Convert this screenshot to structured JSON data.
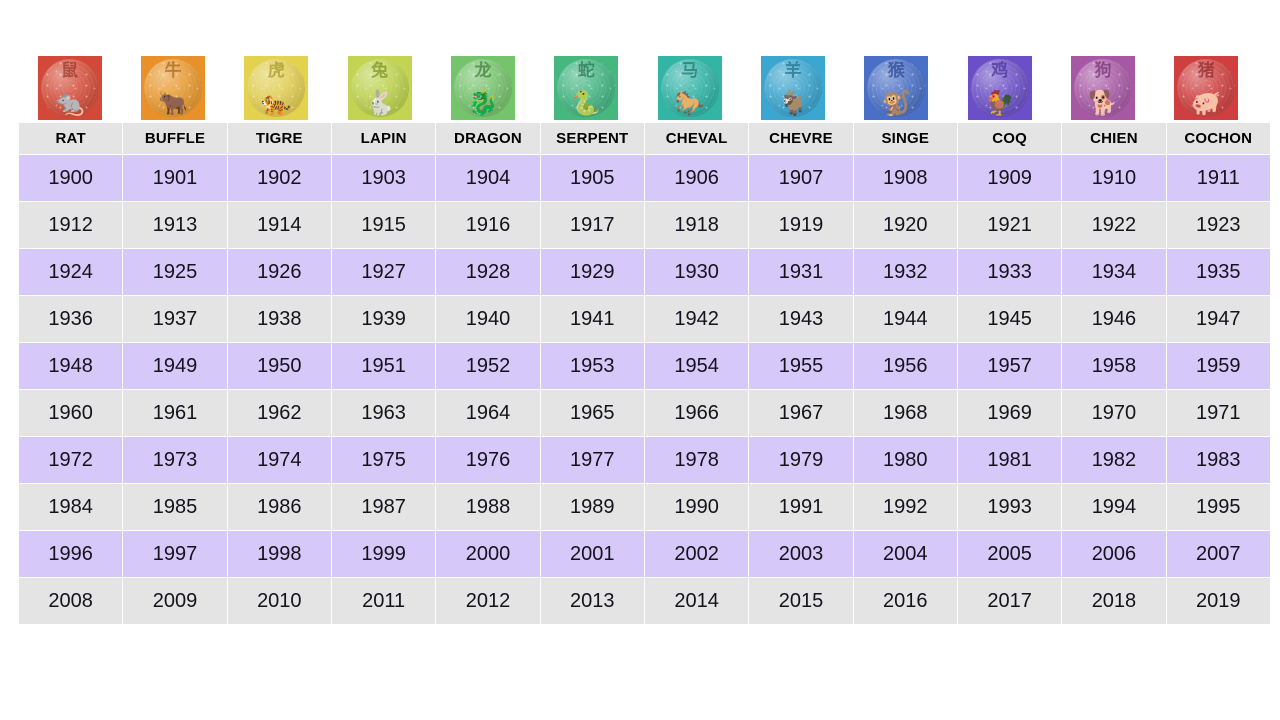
{
  "page": {
    "background": "#ffffff",
    "row_color_alt": "#d6c9fa",
    "row_color_base": "#e4e4e4",
    "header_background": "#e4e4e4"
  },
  "zodiac": {
    "signs": [
      {
        "label": "RAT",
        "icon_name": "zodiac-icon-rat",
        "color": "#d2493a",
        "disc_color": "#d4513f",
        "glyph_cn": "鼠",
        "glyph_animal": "🐀",
        "glyph_color": "#8e2b20",
        "animal_color": "#f0b9a0"
      },
      {
        "label": "BUFFLE",
        "icon_name": "zodiac-icon-buffle",
        "color": "#e8912b",
        "disc_color": "#e79a33",
        "glyph_cn": "牛",
        "glyph_animal": "🐂",
        "glyph_color": "#9c5c12",
        "animal_color": "#f6d6a8"
      },
      {
        "label": "TIGRE",
        "icon_name": "zodiac-icon-tigre",
        "color": "#e4d24e",
        "disc_color": "#e0ce55",
        "glyph_cn": "虎",
        "glyph_animal": "🐅",
        "glyph_color": "#9a8c1b",
        "animal_color": "#f6f0bd"
      },
      {
        "label": "LAPIN",
        "icon_name": "zodiac-icon-lapin",
        "color": "#c3d452",
        "disc_color": "#bcd14f",
        "glyph_cn": "兔",
        "glyph_animal": "🐇",
        "glyph_color": "#6f8417",
        "animal_color": "#f1f7d2"
      },
      {
        "label": "DRAGON",
        "icon_name": "zodiac-icon-dragon",
        "color": "#74c46b",
        "disc_color": "#77c26e",
        "glyph_cn": "龙",
        "glyph_animal": "🐉",
        "glyph_color": "#336f2c",
        "animal_color": "#e2f4df"
      },
      {
        "label": "SERPENT",
        "icon_name": "zodiac-icon-serpent",
        "color": "#46b87e",
        "disc_color": "#46b584",
        "glyph_cn": "蛇",
        "glyph_animal": "🐍",
        "glyph_color": "#176b43",
        "animal_color": "#d9f3e6"
      },
      {
        "label": "CHEVAL",
        "icon_name": "zodiac-icon-cheval",
        "color": "#32b5a3",
        "disc_color": "#33b3a6",
        "glyph_cn": "马",
        "glyph_animal": "🐎",
        "glyph_color": "#12685f",
        "animal_color": "#d5f2ed"
      },
      {
        "label": "CHEVRE",
        "icon_name": "zodiac-icon-chevre",
        "color": "#3ba6cf",
        "disc_color": "#3ca4cd",
        "glyph_cn": "羊",
        "glyph_animal": "🐐",
        "glyph_color": "#13627f",
        "animal_color": "#d6eef8"
      },
      {
        "label": "SINGE",
        "icon_name": "zodiac-icon-singe",
        "color": "#4a6fc6",
        "disc_color": "#4d72c5",
        "glyph_cn": "猴",
        "glyph_animal": "🐒",
        "glyph_color": "#22398c",
        "animal_color": "#dbe3f6"
      },
      {
        "label": "COQ",
        "icon_name": "zodiac-icon-coq",
        "color": "#6b4fc8",
        "disc_color": "#6d53c6",
        "glyph_cn": "鸡",
        "glyph_animal": "🐓",
        "glyph_color": "#3a228c",
        "animal_color": "#e0daf7"
      },
      {
        "label": "CHIEN",
        "icon_name": "zodiac-icon-chien",
        "color": "#a758a4",
        "disc_color": "#a85ca6",
        "glyph_cn": "狗",
        "glyph_animal": "🐕",
        "glyph_color": "#6b2469",
        "animal_color": "#f2dcf1"
      },
      {
        "label": "COCHON",
        "icon_name": "zodiac-icon-cochon",
        "color": "#cf3f3f",
        "disc_color": "#ce4444",
        "glyph_cn": "猪",
        "glyph_animal": "🐖",
        "glyph_color": "#861d1d",
        "animal_color": "#f7cfcb"
      }
    ],
    "headers": [
      "RAT",
      "BUFFLE",
      "TIGRE",
      "LAPIN",
      "DRAGON",
      "SERPENT",
      "CHEVAL",
      "CHEVRE",
      "SINGE",
      "COQ",
      "CHIEN",
      "COCHON"
    ],
    "rows": [
      [
        "1900",
        "1901",
        "1902",
        "1903",
        "1904",
        "1905",
        "1906",
        "1907",
        "1908",
        "1909",
        "1910",
        "1911"
      ],
      [
        "1912",
        "1913",
        "1914",
        "1915",
        "1916",
        "1917",
        "1918",
        "1919",
        "1920",
        "1921",
        "1922",
        "1923"
      ],
      [
        "1924",
        "1925",
        "1926",
        "1927",
        "1928",
        "1929",
        "1930",
        "1931",
        "1932",
        "1933",
        "1934",
        "1935"
      ],
      [
        "1936",
        "1937",
        "1938",
        "1939",
        "1940",
        "1941",
        "1942",
        "1943",
        "1944",
        "1945",
        "1946",
        "1947"
      ],
      [
        "1948",
        "1949",
        "1950",
        "1951",
        "1952",
        "1953",
        "1954",
        "1955",
        "1956",
        "1957",
        "1958",
        "1959"
      ],
      [
        "1960",
        "1961",
        "1962",
        "1963",
        "1964",
        "1965",
        "1966",
        "1967",
        "1968",
        "1969",
        "1970",
        "1971"
      ],
      [
        "1972",
        "1973",
        "1974",
        "1975",
        "1976",
        "1977",
        "1978",
        "1979",
        "1980",
        "1981",
        "1982",
        "1983"
      ],
      [
        "1984",
        "1985",
        "1986",
        "1987",
        "1988",
        "1989",
        "1990",
        "1991",
        "1992",
        "1993",
        "1994",
        "1995"
      ],
      [
        "1996",
        "1997",
        "1998",
        "1999",
        "2000",
        "2001",
        "2002",
        "2003",
        "2004",
        "2005",
        "2006",
        "2007"
      ],
      [
        "2008",
        "2009",
        "2010",
        "2011",
        "2012",
        "2013",
        "2014",
        "2015",
        "2016",
        "2017",
        "2018",
        "2019"
      ]
    ]
  }
}
